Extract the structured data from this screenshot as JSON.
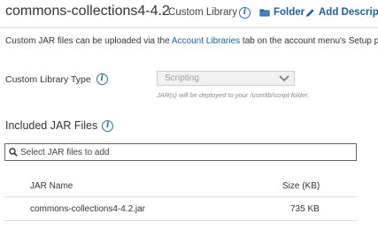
{
  "header": {
    "title": "commons-collections4-4.2",
    "subtitle": "- Custom Library",
    "folder_link": "Folder",
    "description_link": "Add Description"
  },
  "notice": {
    "before": "Custom JAR files can be uploaded via the ",
    "link": "Account Libraries",
    "after": " tab on the account menu's Setup page."
  },
  "library_type": {
    "label": "Custom Library Type",
    "selected": "Scripting",
    "hint": "JAR(s) will be deployed to your /userlib/script folder."
  },
  "jar_files": {
    "title": "Included JAR Files",
    "search_placeholder": "Select JAR files to add",
    "columns": {
      "name": "JAR Name",
      "size": "Size (KB)"
    },
    "rows": [
      {
        "name": "commons-collections4-4.2.jar",
        "size": "735 KB"
      }
    ]
  },
  "colors": {
    "link": "#1f5f9a",
    "icon": "#2f6ea8",
    "border": "#dcdcdc"
  }
}
